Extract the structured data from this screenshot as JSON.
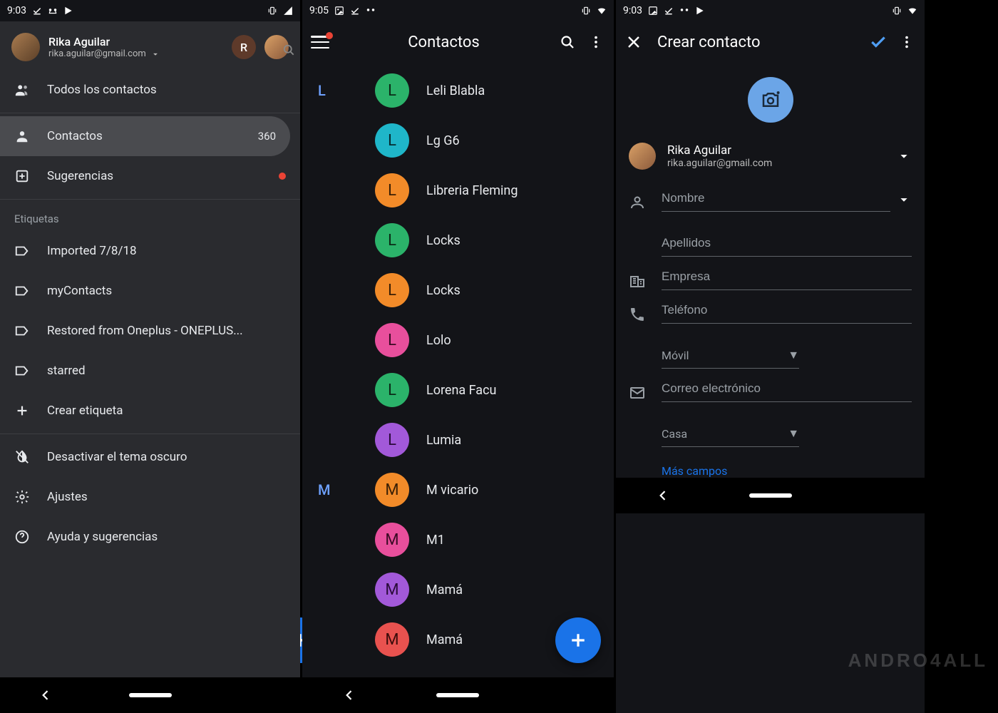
{
  "pane1": {
    "status_time": "9:03",
    "user": {
      "name": "Rika Aguilar",
      "email": "rika.aguilar@gmail.com",
      "letter": "R"
    },
    "items": {
      "all_contacts": "Todos los contactos",
      "contacts": "Contactos",
      "contacts_count": "360",
      "suggestions": "Sugerencias"
    },
    "labels_title": "Etiquetas",
    "labels": [
      "Imported 7/8/18",
      "myContacts",
      "Restored from Oneplus - ONEPLUS...",
      "starred"
    ],
    "create_label": "Crear etiqueta",
    "dark": "Desactivar el tema oscuro",
    "settings": "Ajustes",
    "help": "Ayuda y sugerencias"
  },
  "pane2": {
    "status_time": "9:05",
    "title": "Contactos",
    "groups": [
      {
        "letter": "L",
        "contacts": [
          {
            "name": "Leli Blabla",
            "color": "#2bb36a",
            "fg": "#0b2b17"
          },
          {
            "name": "Lg G6",
            "color": "#1fb6c9",
            "fg": "#062a2f"
          },
          {
            "name": "Libreria Fleming",
            "color": "#f28b29",
            "fg": "#3a1f05"
          },
          {
            "name": "Locks",
            "color": "#2bb36a",
            "fg": "#0b2b17"
          },
          {
            "name": "Locks",
            "color": "#f28b29",
            "fg": "#3a1f05"
          },
          {
            "name": "Lolo",
            "color": "#e84f9c",
            "fg": "#3a0a24"
          },
          {
            "name": "Lorena Facu",
            "color": "#2bb36a",
            "fg": "#0b2b17"
          },
          {
            "name": "Lumia",
            "color": "#a259d9",
            "fg": "#2a0b3a"
          }
        ]
      },
      {
        "letter": "M",
        "contacts": [
          {
            "name": "M vicario",
            "color": "#f28b29",
            "fg": "#3a1f05"
          },
          {
            "name": "M1",
            "color": "#e84f9c",
            "fg": "#3a0a24"
          },
          {
            "name": "Mamá",
            "color": "#a259d9",
            "fg": "#2a0b3a"
          },
          {
            "name": "Mamá",
            "color": "#e8524f",
            "fg": "#3a0b0a"
          }
        ]
      }
    ]
  },
  "pane3": {
    "status_time": "9:03",
    "title": "Crear contacto",
    "account": {
      "name": "Rika Aguilar",
      "email": "rika.aguilar@gmail.com"
    },
    "fields": {
      "name": "Nombre",
      "lastname": "Apellidos",
      "company": "Empresa",
      "phone": "Teléfono",
      "phone_type": "Móvil",
      "email": "Correo electrónico",
      "email_type": "Casa",
      "more": "Más campos"
    }
  },
  "watermark": "ANDRO4ALL"
}
